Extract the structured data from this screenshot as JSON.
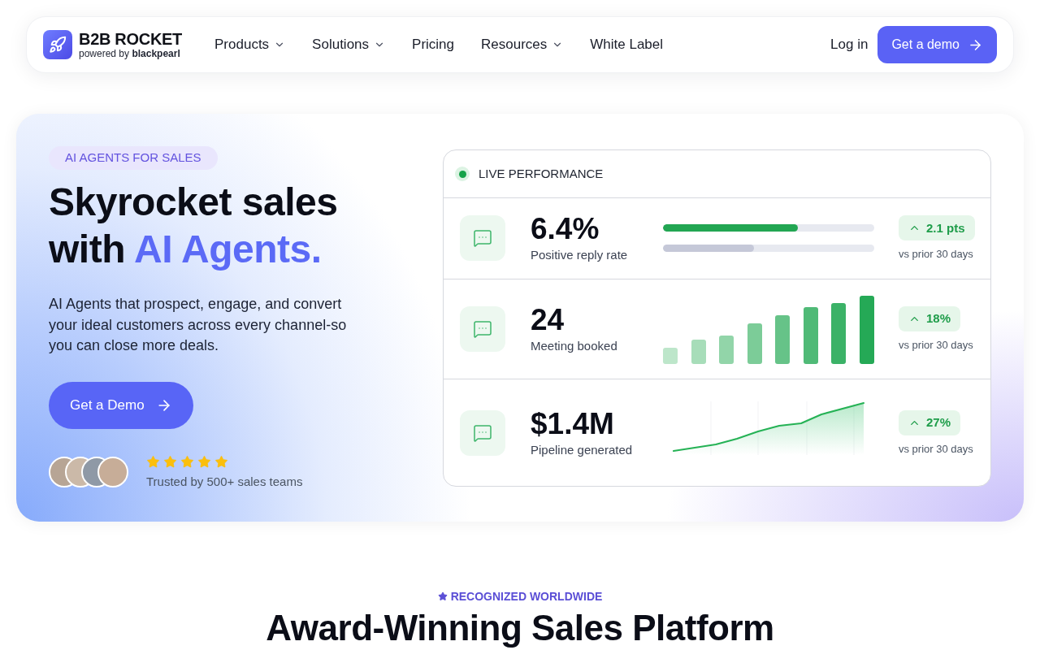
{
  "nav": {
    "logo": {
      "name": "B2B ROCKET",
      "tagline": "powered by **blackpearl**"
    },
    "items": [
      {
        "label": "Products",
        "dropdown": true
      },
      {
        "label": "Solutions",
        "dropdown": true
      },
      {
        "label": "Pricing",
        "dropdown": false
      },
      {
        "label": "Resources",
        "dropdown": true
      },
      {
        "label": "White Label",
        "dropdown": false
      }
    ],
    "login": "Log in",
    "cta": "Get a demo"
  },
  "hero": {
    "badge": "AI AGENTS FOR SALES",
    "headline": "Skyrocket sales with",
    "headline_highlight": "AI Agents.",
    "description": "AI Agents that prospect, engage, and convert your ideal customers across every channel-so you can close more deals.",
    "cta": "Get a Demo",
    "rating": {
      "stars": 5,
      "caption": "Trusted by 500+ sales teams"
    }
  },
  "performance": {
    "title": "LIVE PERFORMANCE",
    "live": true,
    "metrics": [
      {
        "kind": "progress",
        "value": "6.4%",
        "label": "Positive reply rate",
        "tracks": [
          {
            "level": 0.64,
            "color": "#22a652"
          },
          {
            "level": 0.43,
            "color": "#c5c8d8"
          }
        ],
        "rising": true,
        "delta": "2.1 pts",
        "comparison": "vs prior 30 days"
      },
      {
        "kind": "bars",
        "value": "24",
        "label": "Meeting booked",
        "rising": true,
        "delta": "18%",
        "comparison": "vs prior 30 days"
      },
      {
        "kind": "area",
        "value": "$1.4M",
        "label": "Pipeline generated",
        "rising": true,
        "delta": "27%",
        "comparison": "vs prior 30 days"
      }
    ]
  },
  "recognition": {
    "eyebrow": "RECOGNIZED WORLDWIDE",
    "heading": "Award-Winning Sales Platform"
  }
}
